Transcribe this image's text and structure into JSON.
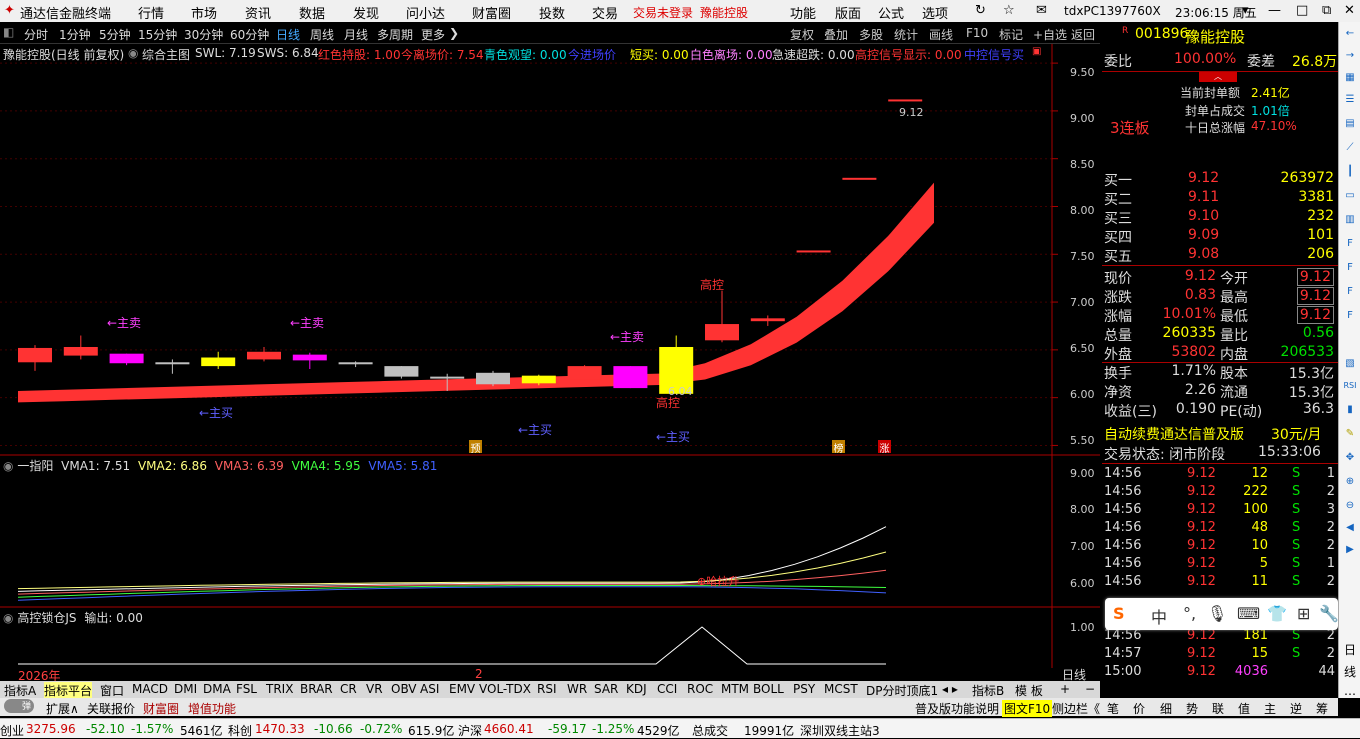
{
  "menu": {
    "app_title": "通达信金融终端",
    "items": [
      "行情",
      "市场",
      "资讯",
      "数据",
      "发现",
      "问小达",
      "财富圈",
      "投数",
      "交易"
    ],
    "login": "交易未登录",
    "stock_name": "豫能控股",
    "right_items": [
      "功能",
      "版面",
      "公式",
      "选项"
    ],
    "machine": "tdxPC1397760X",
    "time": "23:06:15 周五"
  },
  "period_bar": {
    "items": [
      "分时",
      "1分钟",
      "5分钟",
      "15分钟",
      "30分钟",
      "60分钟",
      "日线",
      "周线",
      "月线",
      "多周期",
      "更多"
    ],
    "active": "日线",
    "controls": [
      "复权",
      "叠加",
      "多股",
      "统计",
      "画线",
      "F10",
      "标记",
      "+自选",
      "返回"
    ]
  },
  "main_indicator": {
    "name": "豫能控股(日线 前复权)",
    "formula": "综合主图",
    "swl": "SWL: 7.19",
    "sws": "SWS: 6.84",
    "red_hold": "红色持股: 1.00",
    "today_exit": "今离场价: 7.54",
    "cyan_watch": "青色观望: 0.00",
    "today_entry": "今进场价",
    "short_buy": "短买: 0.00",
    "white_exit": "白色离场: 0.00",
    "sharp_drop": "急速超跌: 0.00",
    "signal_show": "高控信号显示: 0.00",
    "signal_extra": "中控信号买"
  },
  "price_axis": [
    "9.50",
    "9.00",
    "8.50",
    "8.00",
    "7.50",
    "7.00",
    "6.50",
    "6.00",
    "5.50"
  ],
  "chart_labels": {
    "main_sell": "←主卖",
    "main_buy": "←主买",
    "high_control": "高控",
    "low_value": "6.04",
    "high_value": "9.12",
    "tag_pre": "预",
    "tag_bang": "榜",
    "tag_zhang": "涨"
  },
  "vma_indicator": {
    "name": "一指阳",
    "vma1": "VMA1: 7.51",
    "vma2": "VMA2: 6.86",
    "vma3": "VMA3: 6.39",
    "vma4": "VMA4: 5.95",
    "vma5": "VMA5: 5.81",
    "axis": [
      "9.00",
      "8.00",
      "7.00",
      "6.00"
    ],
    "mark": "哈拉升"
  },
  "lock_indicator": {
    "name": "高控锁仓JS",
    "output": "输出: 0.00",
    "axis": "1.00"
  },
  "time_axis": {
    "year": "2026年",
    "month": "2",
    "mode": "日线"
  },
  "chart_data": {
    "type": "candlestick",
    "title": "豫能控股(日线 前复权)",
    "ylim": [
      5.4,
      9.7
    ],
    "candles": [
      {
        "o": 6.37,
        "h": 6.55,
        "l": 6.28,
        "c": 6.52,
        "color": "red"
      },
      {
        "o": 6.44,
        "h": 6.65,
        "l": 6.4,
        "c": 6.53,
        "color": "red"
      },
      {
        "o": 6.36,
        "h": 6.46,
        "l": 6.34,
        "c": 6.46,
        "color": "magenta"
      },
      {
        "o": 6.35,
        "h": 6.4,
        "l": 6.25,
        "c": 6.37,
        "color": "white"
      },
      {
        "o": 6.33,
        "h": 6.48,
        "l": 6.3,
        "c": 6.42,
        "color": "yellow"
      },
      {
        "o": 6.4,
        "h": 6.53,
        "l": 6.38,
        "c": 6.48,
        "color": "red"
      },
      {
        "o": 6.39,
        "h": 6.47,
        "l": 6.3,
        "c": 6.45,
        "color": "magenta"
      },
      {
        "o": 6.35,
        "h": 6.38,
        "l": 6.32,
        "c": 6.37,
        "color": "white"
      },
      {
        "o": 6.22,
        "h": 6.33,
        "l": 6.2,
        "c": 6.33,
        "color": "white"
      },
      {
        "o": 6.21,
        "h": 6.25,
        "l": 6.07,
        "c": 6.22,
        "color": "white"
      },
      {
        "o": 6.14,
        "h": 6.28,
        "l": 6.12,
        "c": 6.26,
        "color": "white"
      },
      {
        "o": 6.15,
        "h": 6.24,
        "l": 6.13,
        "c": 6.23,
        "color": "yellow"
      },
      {
        "o": 6.19,
        "h": 6.34,
        "l": 6.17,
        "c": 6.33,
        "color": "red"
      },
      {
        "o": 6.1,
        "h": 6.33,
        "l": 6.1,
        "c": 6.33,
        "color": "magenta"
      },
      {
        "o": 6.04,
        "h": 6.65,
        "l": 6.04,
        "c": 6.53,
        "color": "yellow"
      },
      {
        "o": 6.6,
        "h": 7.12,
        "l": 6.58,
        "c": 6.77,
        "color": "red"
      },
      {
        "o": 6.8,
        "h": 6.86,
        "l": 6.75,
        "c": 6.83,
        "color": "red"
      },
      {
        "o": 7.54,
        "h": 7.54,
        "l": 7.54,
        "c": 7.54,
        "color": "red"
      },
      {
        "o": 8.3,
        "h": 8.3,
        "l": 8.3,
        "c": 8.3,
        "color": "red"
      },
      {
        "o": 9.12,
        "h": 9.12,
        "l": 9.12,
        "c": 9.12,
        "color": "red"
      }
    ]
  },
  "quote": {
    "code": "001896",
    "name": "豫能控股",
    "weibi_label": "委比",
    "weibi": "100.00%",
    "weicha_label": "委差",
    "weicha": "26.8万",
    "limit_amount_label": "当前封单额",
    "limit_amount": "2.41亿",
    "limit_ratio_label": "封单占成交",
    "limit_ratio": "1.01倍",
    "ten_day_label": "十日总涨幅",
    "ten_day": "47.10%",
    "streak": "3连板",
    "bids": [
      {
        "label": "买一",
        "price": "9.12",
        "vol": "263972"
      },
      {
        "label": "买二",
        "price": "9.11",
        "vol": "3381"
      },
      {
        "label": "买三",
        "price": "9.10",
        "vol": "232"
      },
      {
        "label": "买四",
        "price": "9.09",
        "vol": "101"
      },
      {
        "label": "买五",
        "price": "9.08",
        "vol": "206"
      }
    ],
    "stats": [
      {
        "l1": "现价",
        "v1": "9.12",
        "l2": "今开",
        "v2": "9.12"
      },
      {
        "l1": "涨跌",
        "v1": "0.83",
        "l2": "最高",
        "v2": "9.12"
      },
      {
        "l1": "涨幅",
        "v1": "10.01%",
        "l2": "最低",
        "v2": "9.12"
      },
      {
        "l1": "总量",
        "v1": "260335",
        "l2": "量比",
        "v2": "0.56"
      },
      {
        "l1": "外盘",
        "v1": "53802",
        "l2": "内盘",
        "v2": "206533"
      },
      {
        "l1": "换手",
        "v1": "1.71%",
        "l2": "股本",
        "v2": "15.3亿"
      },
      {
        "l1": "净资",
        "v1": "2.26",
        "l2": "流通",
        "v2": "15.3亿"
      },
      {
        "l1": "收益(三)",
        "v1": "0.190",
        "l2": "PE(动)",
        "v2": "36.3"
      }
    ],
    "ad": "自动续费通达信普及版",
    "ad_price": "30元/月",
    "trade_state": "交易状态: 闭市阶段",
    "trade_time": "15:33:06",
    "ticks": [
      {
        "t": "14:56",
        "p": "9.12",
        "v": "12",
        "s": "S",
        "n": "1"
      },
      {
        "t": "14:56",
        "p": "9.12",
        "v": "222",
        "s": "S",
        "n": "2"
      },
      {
        "t": "14:56",
        "p": "9.12",
        "v": "100",
        "s": "S",
        "n": "3"
      },
      {
        "t": "14:56",
        "p": "9.12",
        "v": "48",
        "s": "S",
        "n": "2"
      },
      {
        "t": "14:56",
        "p": "9.12",
        "v": "10",
        "s": "S",
        "n": "2"
      },
      {
        "t": "14:56",
        "p": "9.12",
        "v": "5",
        "s": "S",
        "n": "1"
      },
      {
        "t": "14:56",
        "p": "9.12",
        "v": "11",
        "s": "S",
        "n": "2"
      },
      {
        "t": "14:56",
        "p": "9.12",
        "v": "181",
        "s": "S",
        "n": "2"
      },
      {
        "t": "14:57",
        "p": "9.12",
        "v": "15",
        "s": "S",
        "n": "2"
      },
      {
        "t": "15:00",
        "p": "9.12",
        "v": "4036",
        "s": "",
        "n": "44"
      }
    ]
  },
  "tabs1": [
    "指标A",
    "指标平台",
    "窗口",
    "MACD",
    "DMI",
    "DMA",
    "FSL",
    "TRIX",
    "BRAR",
    "CR",
    "VR",
    "OBV",
    "ASI",
    "EMV",
    "VOL-TDX",
    "RSI",
    "WR",
    "SAR",
    "KDJ",
    "CCI",
    "ROC",
    "MTM",
    "BOLL",
    "PSY",
    "MCST",
    "DP分时顶底1",
    "指标B",
    "模 板"
  ],
  "tabs2": [
    "扩展∧",
    "关联报价",
    "财富圈",
    "增值功能"
  ],
  "tabs2_right": [
    "普及版功能说明",
    "图文F10",
    "侧边栏《",
    "笔",
    "价",
    "细",
    "势",
    "联",
    "值",
    "主",
    "逆",
    "筹"
  ],
  "status": {
    "i1n": "创业",
    "i1v": "3275.96",
    "i1c": "-52.10",
    "i1p": "-1.57%",
    "i1a": "5461亿",
    "i2n": "科创",
    "i2v": "1470.33",
    "i2c": "-10.66",
    "i2p": "-0.72%",
    "i2a": "615.9亿",
    "i3n": "沪深",
    "i3v": "4660.41",
    "i3c": "-59.17",
    "i3p": "-1.25%",
    "i3a": "4529亿",
    "total_label": "总成交",
    "total": "19991亿",
    "server": "深圳双线主站3"
  },
  "ime": [
    "中",
    "°,",
    "🎙",
    "⌨",
    "👕",
    "⊞",
    "🔧"
  ]
}
